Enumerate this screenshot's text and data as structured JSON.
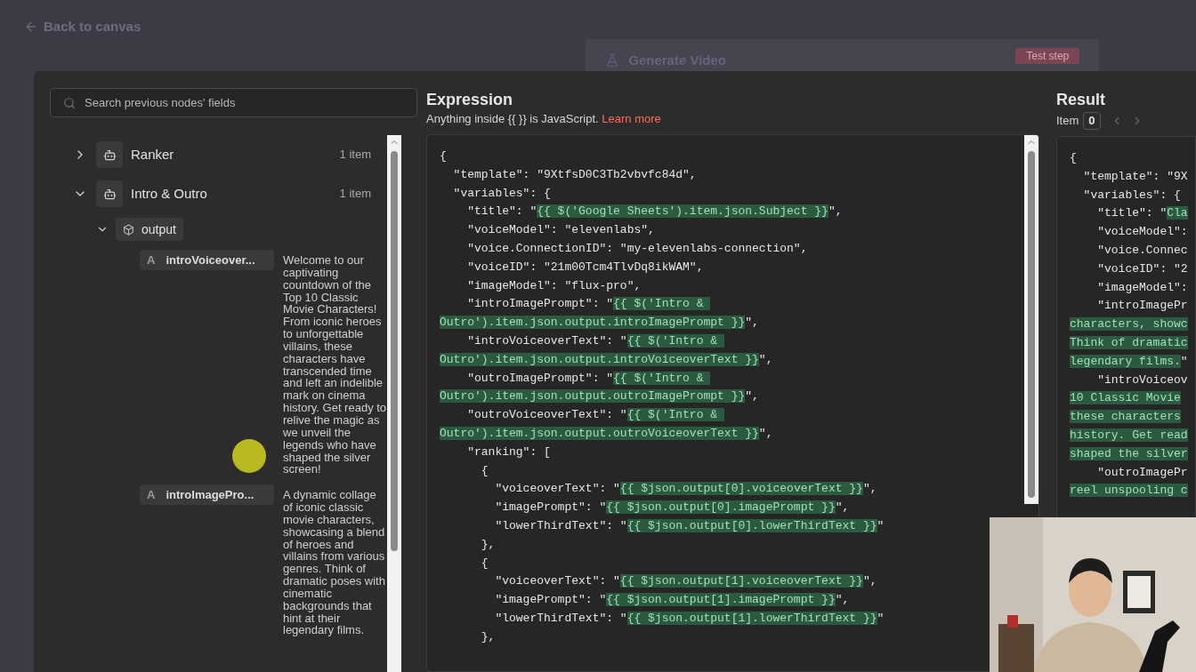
{
  "back_link": "Back to canvas",
  "background_node": {
    "title": "Generate Video",
    "button": "Test step"
  },
  "search": {
    "placeholder": "Search previous nodes' fields"
  },
  "tree": [
    {
      "name": "Ranker",
      "count": "1 item",
      "expanded": false
    },
    {
      "name": "Intro & Outro",
      "count": "1 item",
      "expanded": true,
      "children": [
        {
          "name": "output",
          "expanded": true,
          "children": [
            {
              "type": "A",
              "key": "introVoiceover...",
              "value": "Welcome to our captivating countdown of the Top 10 Classic Movie Characters! From iconic heroes to unforgettable villains, these characters have transcended time and left an indelible mark on cinema history. Get ready to relive the magic as we unveil the legends who have shaped the silver screen!"
            },
            {
              "type": "A",
              "key": "introImagePro...",
              "value": "A dynamic collage of iconic classic movie characters, showcasing a blend of heroes and villains from various genres. Think of dramatic poses with cinematic backgrounds that hint at their legendary films."
            }
          ]
        }
      ]
    }
  ],
  "expression": {
    "title": "Expression",
    "hint": "Anything inside {{  }} is JavaScript.",
    "link": "Learn more",
    "lines": [
      [
        {
          "text": "{",
          "expr": false
        }
      ],
      [
        {
          "text": "  \"template\": \"9XtfsD0C3Tb2vbvfc84d\",",
          "expr": false
        }
      ],
      [
        {
          "text": "  \"variables\": {",
          "expr": false
        }
      ],
      [
        {
          "text": "    \"title\": \"",
          "expr": false
        },
        {
          "text": "{{ $('Google Sheets').item.json.Subject }}",
          "expr": true
        },
        {
          "text": "\",",
          "expr": false
        }
      ],
      [
        {
          "text": "    \"voiceModel\": \"elevenlabs\",",
          "expr": false
        }
      ],
      [
        {
          "text": "    \"voice.ConnectionID\": \"my-elevenlabs-connection\",",
          "expr": false
        }
      ],
      [
        {
          "text": "    \"voiceID\": \"21m00Tcm4TlvDq8ikWAM\",",
          "expr": false
        }
      ],
      [
        {
          "text": "    \"imageModel\": \"flux-pro\",",
          "expr": false
        }
      ],
      [
        {
          "text": "    \"introImagePrompt\": \"",
          "expr": false
        },
        {
          "text": "{{ $('Intro & ",
          "expr": true
        }
      ],
      [
        {
          "text": "Outro').item.json.output.introImagePrompt }}",
          "expr": true
        },
        {
          "text": "\",",
          "expr": false
        }
      ],
      [
        {
          "text": "    \"introVoiceoverText\": \"",
          "expr": false
        },
        {
          "text": "{{ $('Intro & ",
          "expr": true
        }
      ],
      [
        {
          "text": "Outro').item.json.output.introVoiceoverText }}",
          "expr": true
        },
        {
          "text": "\",",
          "expr": false
        }
      ],
      [
        {
          "text": "    \"outroImagePrompt\": \"",
          "expr": false
        },
        {
          "text": "{{ $('Intro & ",
          "expr": true
        }
      ],
      [
        {
          "text": "Outro').item.json.output.outroImagePrompt }}",
          "expr": true
        },
        {
          "text": "\",",
          "expr": false
        }
      ],
      [
        {
          "text": "    \"outroVoiceoverText\": \"",
          "expr": false
        },
        {
          "text": "{{ $('Intro & ",
          "expr": true
        }
      ],
      [
        {
          "text": "Outro').item.json.output.outroVoiceoverText }}",
          "expr": true
        },
        {
          "text": "\",",
          "expr": false
        }
      ],
      [
        {
          "text": "    \"ranking\": [",
          "expr": false
        }
      ],
      [
        {
          "text": "      {",
          "expr": false
        }
      ],
      [
        {
          "text": "        \"voiceoverText\": \"",
          "expr": false
        },
        {
          "text": "{{ $json.output[0].voiceoverText }}",
          "expr": true
        },
        {
          "text": "\",",
          "expr": false
        }
      ],
      [
        {
          "text": "        \"imagePrompt\": \"",
          "expr": false
        },
        {
          "text": "{{ $json.output[0].imagePrompt }}",
          "expr": true
        },
        {
          "text": "\",",
          "expr": false
        }
      ],
      [
        {
          "text": "        \"lowerThirdText\": \"",
          "expr": false
        },
        {
          "text": "{{ $json.output[0].lowerThirdText }}",
          "expr": true
        },
        {
          "text": "\"",
          "expr": false
        }
      ],
      [
        {
          "text": "      },",
          "expr": false
        }
      ],
      [
        {
          "text": "      {",
          "expr": false
        }
      ],
      [
        {
          "text": "        \"voiceoverText\": \"",
          "expr": false
        },
        {
          "text": "{{ $json.output[1].voiceoverText }}",
          "expr": true
        },
        {
          "text": "\",",
          "expr": false
        }
      ],
      [
        {
          "text": "        \"imagePrompt\": \"",
          "expr": false
        },
        {
          "text": "{{ $json.output[1].imagePrompt }}",
          "expr": true
        },
        {
          "text": "\",",
          "expr": false
        }
      ],
      [
        {
          "text": "        \"lowerThirdText\": \"",
          "expr": false
        },
        {
          "text": "{{ $json.output[1].lowerThirdText }}",
          "expr": true
        },
        {
          "text": "\"",
          "expr": false
        }
      ],
      [
        {
          "text": "      },",
          "expr": false
        }
      ]
    ]
  },
  "result": {
    "title": "Result",
    "item_label": "Item",
    "item_value": "0",
    "lines": [
      [
        {
          "text": "{",
          "expr": false
        }
      ],
      [
        {
          "text": "  \"template\": \"9X",
          "expr": false
        }
      ],
      [
        {
          "text": "  \"variables\": {",
          "expr": false
        }
      ],
      [
        {
          "text": "    \"title\": \"",
          "expr": false
        },
        {
          "text": "Cla",
          "expr": true
        }
      ],
      [
        {
          "text": "    \"voiceModel\":",
          "expr": false
        }
      ],
      [
        {
          "text": "    \"voice.Connec",
          "expr": false
        }
      ],
      [
        {
          "text": "    \"voiceID\": \"2",
          "expr": false
        }
      ],
      [
        {
          "text": "    \"imageModel\":",
          "expr": false
        }
      ],
      [
        {
          "text": "    \"introImagePr",
          "expr": false
        }
      ],
      [
        {
          "text": "characters, showc",
          "expr": true
        }
      ],
      [
        {
          "text": "Think of dramatic",
          "expr": true
        }
      ],
      [
        {
          "text": "legendary films.",
          "expr": true
        },
        {
          "text": "\"",
          "expr": false
        }
      ],
      [
        {
          "text": "    \"introVoiceov",
          "expr": false
        }
      ],
      [
        {
          "text": "10 Classic Movie",
          "expr": true
        }
      ],
      [
        {
          "text": "these characters",
          "expr": true
        }
      ],
      [
        {
          "text": "history. Get read",
          "expr": true
        }
      ],
      [
        {
          "text": "shaped the silver",
          "expr": true
        }
      ],
      [
        {
          "text": "    \"outroImagePr",
          "expr": false
        }
      ],
      [
        {
          "text": "reel unspooling c",
          "expr": true
        }
      ]
    ]
  }
}
